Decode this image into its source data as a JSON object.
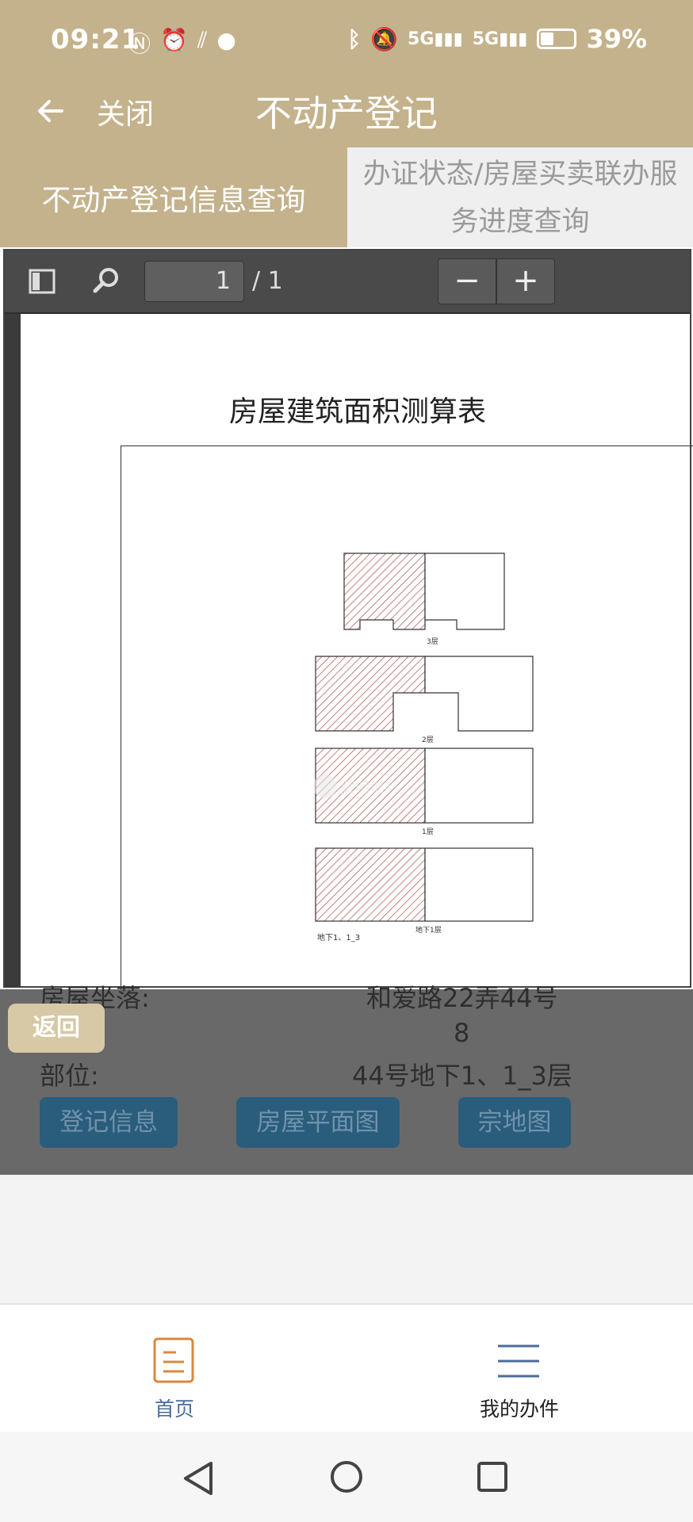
{
  "status_bar": {
    "time": "09:21",
    "battery": "39%",
    "left_icons": [
      "nfc-icon",
      "alarm-icon",
      "vpn-icon",
      "wechat-icon"
    ],
    "right_icons": [
      "bluetooth-icon",
      "mute-icon",
      "5g-signal-icon",
      "5g-signal-icon",
      "battery-icon"
    ]
  },
  "header": {
    "back_icon": "arrow-left-icon",
    "close_label": "关闭",
    "title": "不动产登记"
  },
  "tabs": [
    {
      "label": "不动产登记信息查询",
      "active": true
    },
    {
      "label_line1": "办证状态/房屋买卖联办服",
      "label_line2": "务进度查询",
      "active": false
    }
  ],
  "pdf_viewer": {
    "toolbar": {
      "sidebar_icon": "sidebar-toggle-icon",
      "search_icon": "search-icon",
      "page_value": "1",
      "page_count": "/ 1",
      "zoom_out": "−",
      "zoom_in": "+"
    },
    "document": {
      "title": "房屋建筑面积测算表",
      "floor_labels": [
        "3层",
        "2层",
        "1层",
        "地下1层"
      ],
      "bottom_note": "地下1、1_3",
      "watermark": "藏明地产"
    }
  },
  "info_overlay": {
    "location_label": "房屋坐落:",
    "location_value": "和爱路22弄44号",
    "room_value": "8",
    "part_label": "部位:",
    "part_value": "44号地下1、1_3层",
    "return_button": "返回",
    "buttons": [
      "登记信息",
      "房屋平面图",
      "宗地图"
    ]
  },
  "bottom_tabs": [
    {
      "label": "首页",
      "icon": "document-icon",
      "active": true
    },
    {
      "label": "我的办件",
      "icon": "menu-icon",
      "active": false
    }
  ],
  "nav_bar": [
    "back-triangle-icon",
    "home-circle-icon",
    "recents-square-icon"
  ],
  "colors": {
    "brand": "#c4b28c",
    "tab_inactive_bg": "#efefef",
    "overlay": "#696969",
    "action_button": "#2a5c7c",
    "active_tab_text": "#4a6b9c",
    "hatch": "#b44a4a"
  }
}
